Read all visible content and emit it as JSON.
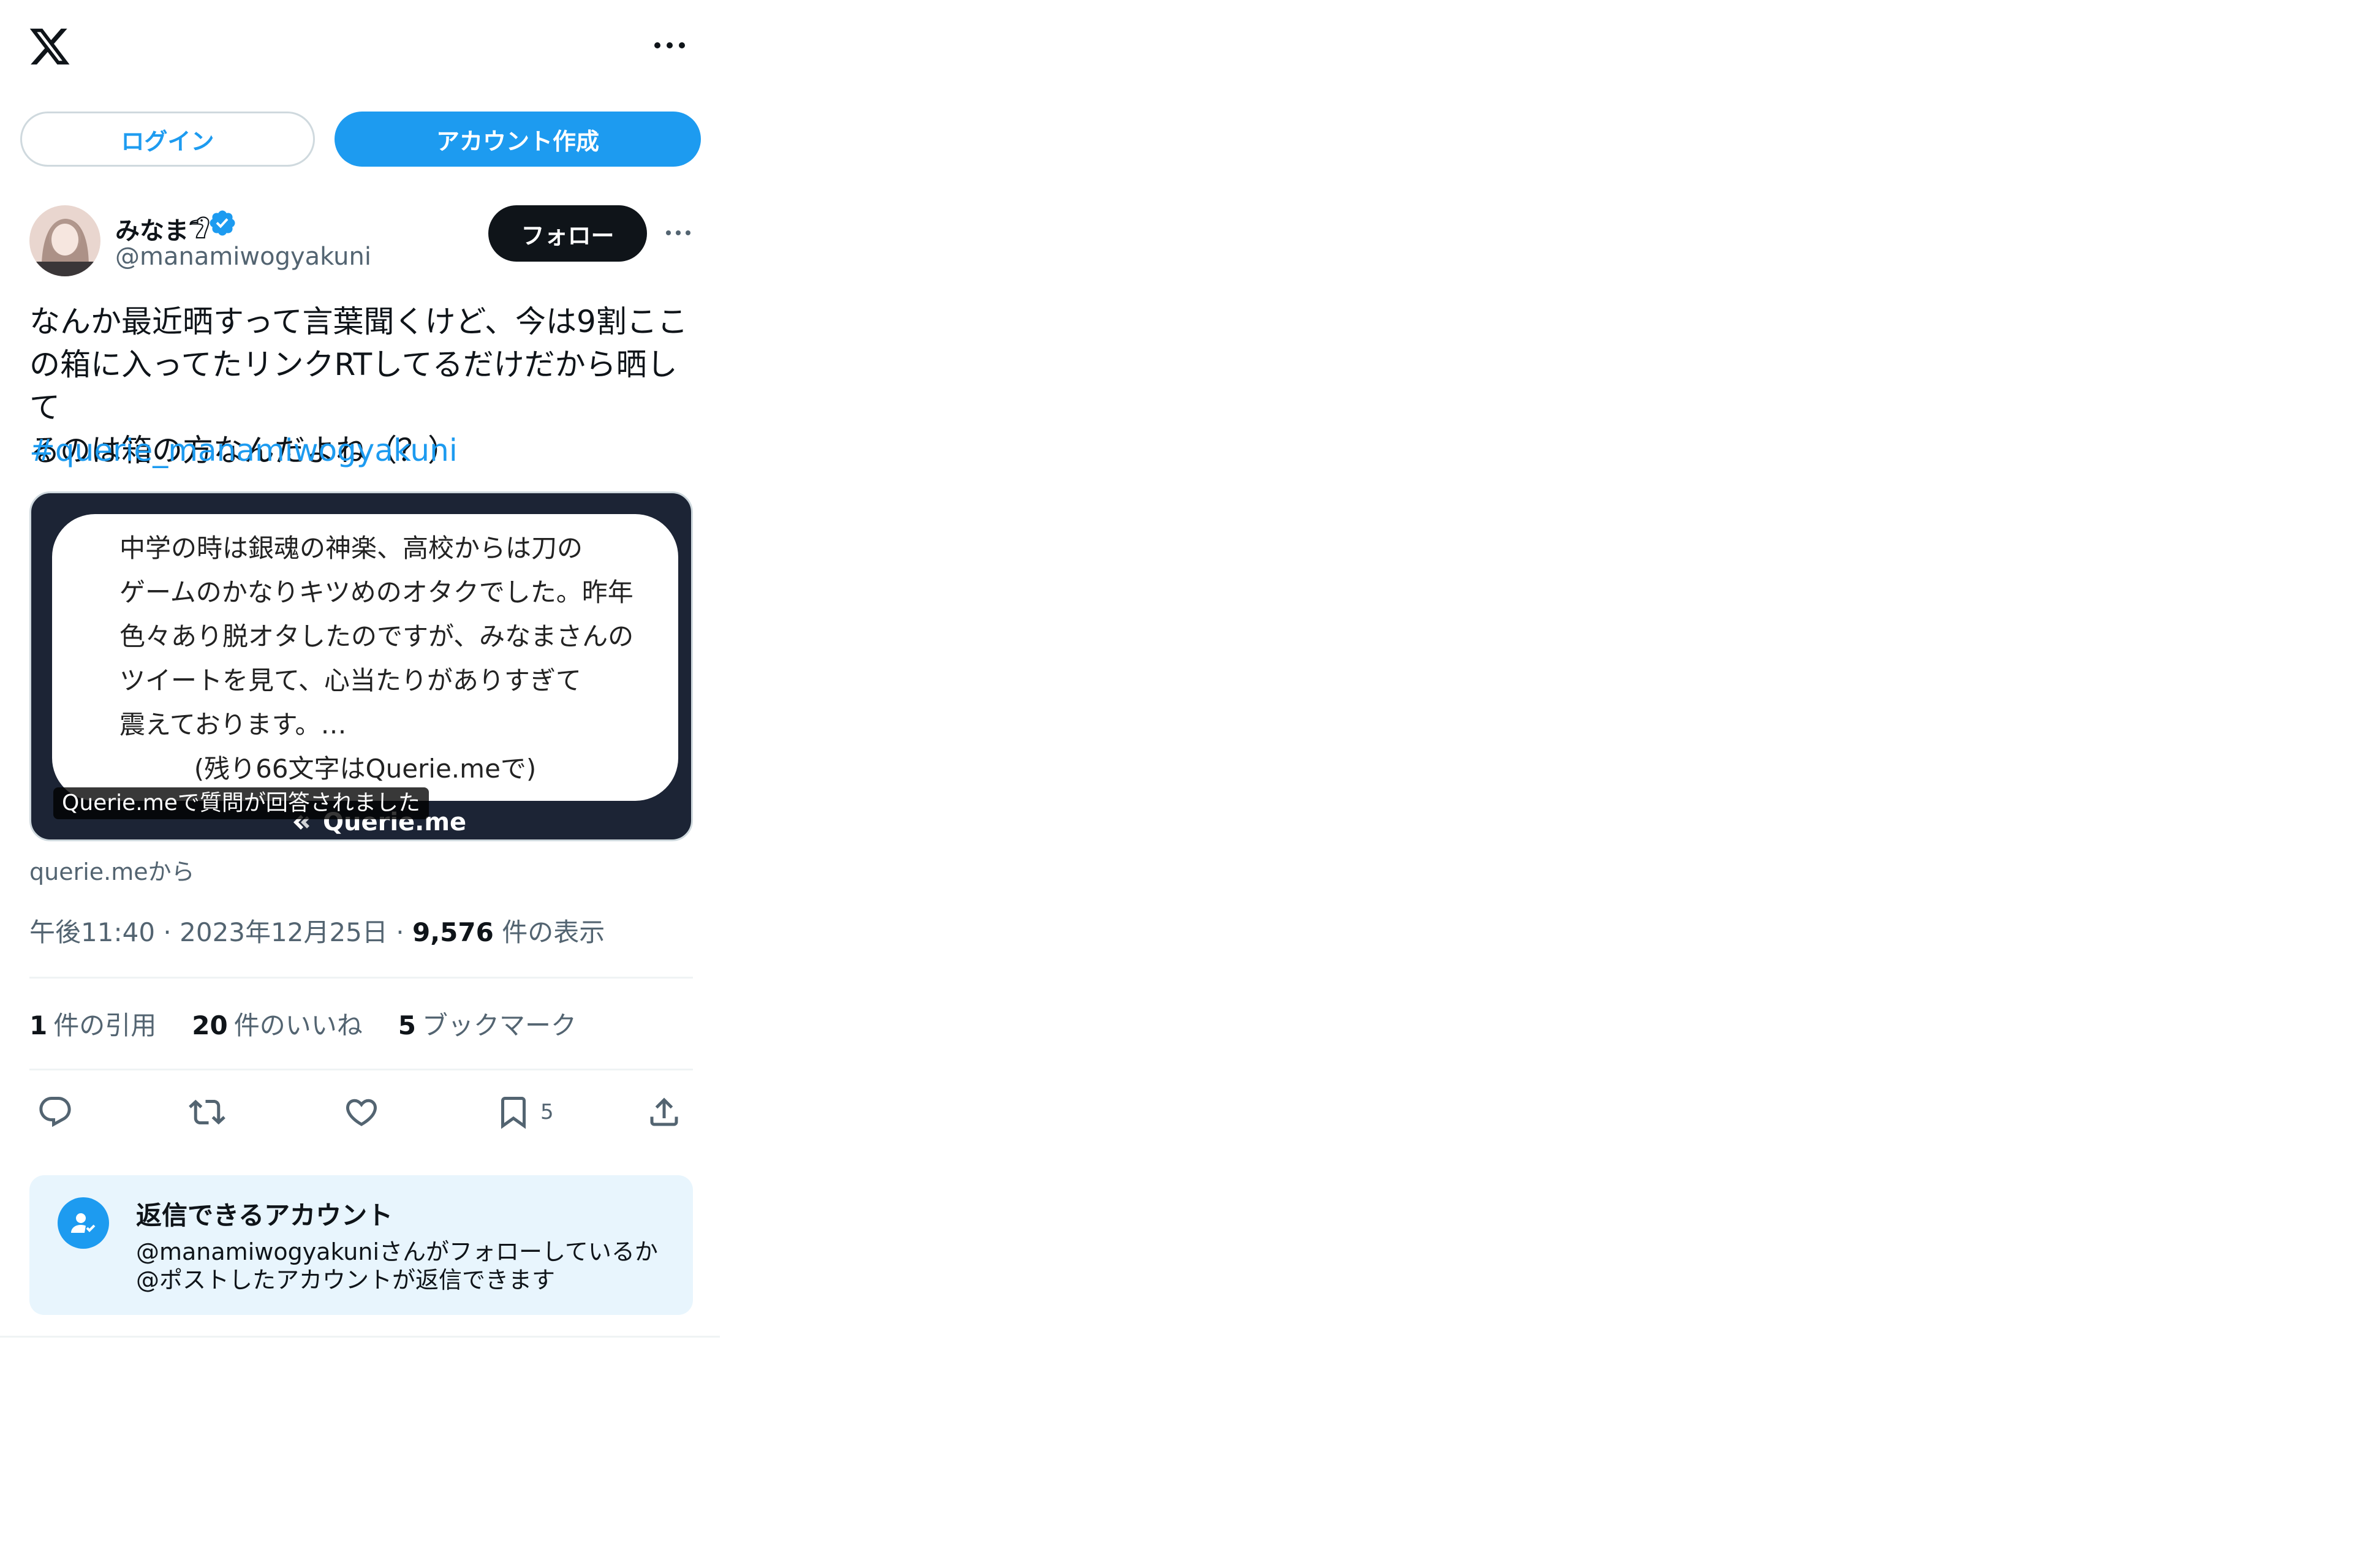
{
  "header": {
    "login_label": "ログイン",
    "signup_label": "アカウント作成"
  },
  "author": {
    "name": "みなま𓅿",
    "handle": "@manamiwogyakuni",
    "follow_label": "フォロー"
  },
  "tweet": {
    "text": "なんか最近晒すって言葉聞くけど、今は9割ここ\nの箱に入ってたリンクRTしてるだけだから晒して\nるのは箱の方なんだよね（？）",
    "hashtag": "#querie_manamiwogyakuni"
  },
  "card": {
    "question": "中学の時は銀魂の神楽、高校からは刀の\nゲームのかなりキツめのオタクでした。昨年\n色々あり脱オタしたのですが、みなまさんの\nツイートを見て、心当たりがありすぎて\n震えております。…",
    "remaining": "(残り66文字はQuerie.meで)",
    "brand": "Querie.me",
    "caption": "Querie.meで質問が回答されました",
    "source": "querie.meから"
  },
  "meta": {
    "time": "午後11:40",
    "date": "2023年12月25日",
    "views_count": "9,576",
    "views_label": "件の表示",
    "separator": "·"
  },
  "stats": {
    "quotes_count": "1",
    "quotes_label": "件の引用",
    "likes_count": "20",
    "likes_label": "件のいいね",
    "bookmarks_count": "5",
    "bookmarks_label": "ブックマーク"
  },
  "actions": {
    "bookmark_count": "5"
  },
  "reply_restriction": {
    "title": "返信できるアカウント",
    "description": "@manamiwogyakuniさんがフォローしているか\n@ポストしたアカウントが返信できます"
  },
  "colors": {
    "accent": "#1d9bf0",
    "text": "#0f1419",
    "secondary": "#536471",
    "card_bg": "#1c2435",
    "reply_bg": "#e8f5fd"
  }
}
